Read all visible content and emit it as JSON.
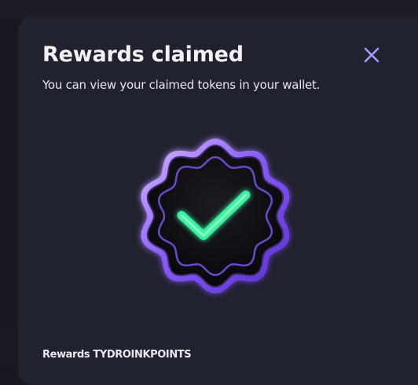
{
  "modal": {
    "title": "Rewards claimed",
    "subtitle": "You can view your claimed tokens in your wallet.",
    "close_icon": "close-icon",
    "badge_icon": "checkmark-badge-icon",
    "footer_label": "Rewards TYDROINKPOINTS"
  },
  "colors": {
    "modal_bg": "#212230",
    "page_bg": "#17171f",
    "accent_purple": "#9b74ff",
    "check_green": "#3cf0a0",
    "close_icon": "#a59dff",
    "text_primary": "#f1f1f6"
  }
}
